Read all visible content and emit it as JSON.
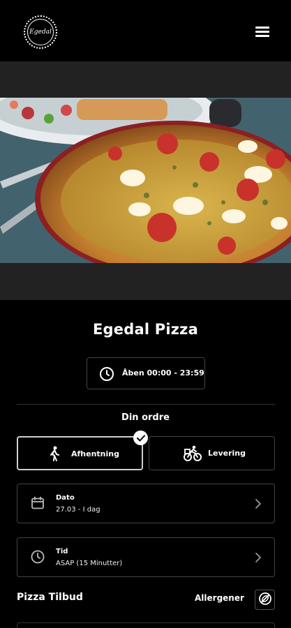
{
  "header": {
    "logo_text": "Egedal",
    "logo_icon": "egedal-logo",
    "menu_icon": "hamburger-icon"
  },
  "restaurant": {
    "name": "Egedal Pizza",
    "hours": "Åben 00:00 - 23:59"
  },
  "order": {
    "title": "Din ordre",
    "options": [
      {
        "label": "Afhentning",
        "icon": "walking-person-icon",
        "selected": true
      },
      {
        "label": "Levering",
        "icon": "bicycle-icon",
        "selected": false
      }
    ],
    "date": {
      "label": "Dato",
      "value": "27.03 - I dag",
      "icon": "calendar-icon"
    },
    "time": {
      "label": "Tid",
      "value": "ASAP (15 Minutter)",
      "icon": "clock-icon"
    }
  },
  "menu": {
    "section_title": "Pizza Tilbud",
    "allergen_label": "Allergener",
    "allergen_icon": "no-allergen-icon"
  },
  "colors": {
    "background": "#000000",
    "hero_band": "#222222",
    "border": "#444444",
    "selected_border": "#cfcfcf"
  }
}
